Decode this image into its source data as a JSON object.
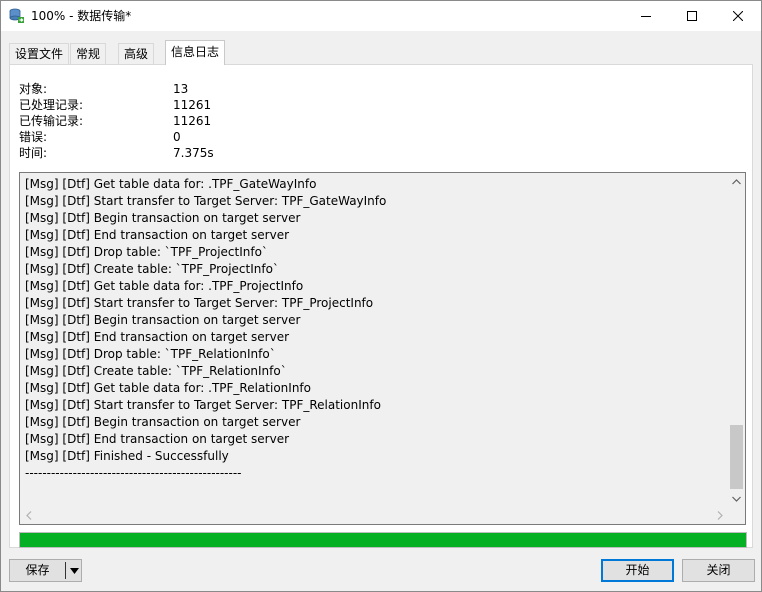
{
  "window": {
    "title": "100% - 数据传输*",
    "icon": "data-transfer-icon"
  },
  "tabs": [
    {
      "label": "设置文件",
      "active": false
    },
    {
      "label": "常规",
      "active": false
    },
    {
      "label": "高级",
      "active": false
    },
    {
      "label": "信息日志",
      "active": true
    }
  ],
  "stats": [
    {
      "label": "对象:",
      "value": "13"
    },
    {
      "label": "已处理记录:",
      "value": "11261"
    },
    {
      "label": "已传输记录:",
      "value": "11261"
    },
    {
      "label": "错误:",
      "value": "0"
    },
    {
      "label": "时间:",
      "value": "7.375s"
    }
  ],
  "log": {
    "lines": [
      "[Msg] [Dtf] Get table data for: .TPF_GateWayInfo",
      "[Msg] [Dtf] Start transfer to Target Server: TPF_GateWayInfo",
      "[Msg] [Dtf] Begin transaction on target server",
      "[Msg] [Dtf] End transaction on target server",
      "[Msg] [Dtf] Drop table: `TPF_ProjectInfo`",
      "[Msg] [Dtf] Create table: `TPF_ProjectInfo`",
      "[Msg] [Dtf] Get table data for: .TPF_ProjectInfo",
      "[Msg] [Dtf] Start transfer to Target Server: TPF_ProjectInfo",
      "[Msg] [Dtf] Begin transaction on target server",
      "[Msg] [Dtf] End transaction on target server",
      "[Msg] [Dtf] Drop table: `TPF_RelationInfo`",
      "[Msg] [Dtf] Create table: `TPF_RelationInfo`",
      "[Msg] [Dtf] Get table data for: .TPF_RelationInfo",
      "[Msg] [Dtf] Start transfer to Target Server: TPF_RelationInfo",
      "[Msg] [Dtf] Begin transaction on target server",
      "[Msg] [Dtf] End transaction on target server",
      "[Msg] [Dtf] Finished - Successfully",
      "--------------------------------------------------"
    ]
  },
  "progress": {
    "fraction": 1.0,
    "color": "#06b025"
  },
  "buttons": {
    "save": "保存",
    "start": "开始",
    "close": "关闭"
  },
  "colors": {
    "accent": "#0078d7"
  }
}
